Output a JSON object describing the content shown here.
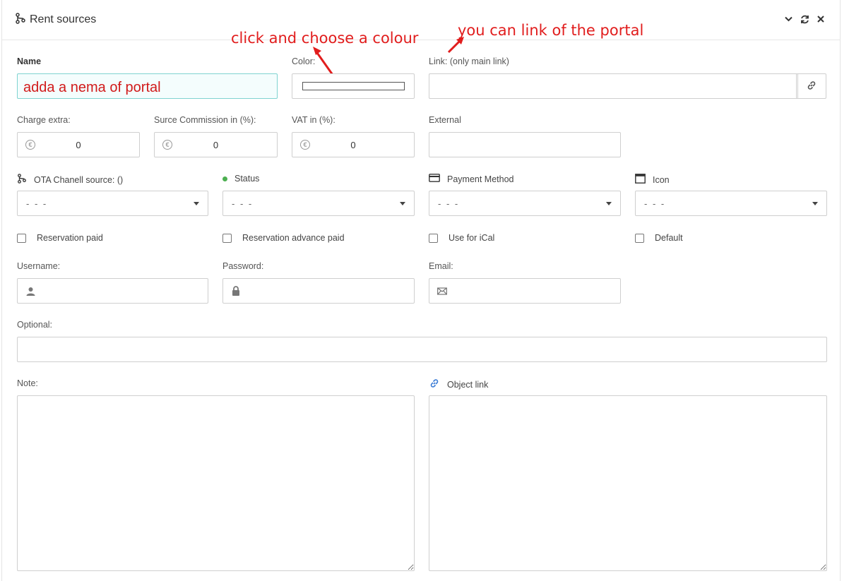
{
  "header": {
    "title": "Rent sources",
    "icon": "fork-source-icon"
  },
  "annotations": {
    "color_hint": "click and choose a colour",
    "link_hint": "you can link of the portal"
  },
  "form": {
    "name_label": "Name",
    "name_value": "adda a nema of portal",
    "color_label": "Color:",
    "link_label": "Link: (only main link)",
    "link_value": "",
    "charge_extra_label": "Charge extra:",
    "charge_extra_value": "0",
    "surce_commission_label": "Surce Commission in (%):",
    "surce_commission_value": "0",
    "vat_label": "VAT in (%):",
    "vat_value": "0",
    "external_label": "External",
    "external_value": "",
    "currency_symbol": "€",
    "ota_label": "OTA Chanell source: ()",
    "ota_value": "- - -",
    "status_label": "Status",
    "status_value": "- - -",
    "status_color": "#4caf50",
    "payment_label": "Payment Method",
    "payment_value": "- - -",
    "icon_label": "Icon",
    "icon_value": "- - -",
    "reservation_paid": "Reservation paid",
    "reservation_advance_paid": "Reservation advance paid",
    "use_for_ical": "Use for iCal",
    "default": "Default",
    "username_label": "Username:",
    "username_value": "",
    "password_label": "Password:",
    "password_value": "",
    "email_label": "Email:",
    "email_value": "",
    "optional_label": "Optional:",
    "optional_value": "",
    "note_label": "Note:",
    "note_value": "",
    "object_link_label": "Object link",
    "object_link_value": ""
  },
  "colors": {
    "annotation": "#e11d1d",
    "focus_border": "#7fd3d0",
    "link_icon": "#3a7bd5"
  }
}
